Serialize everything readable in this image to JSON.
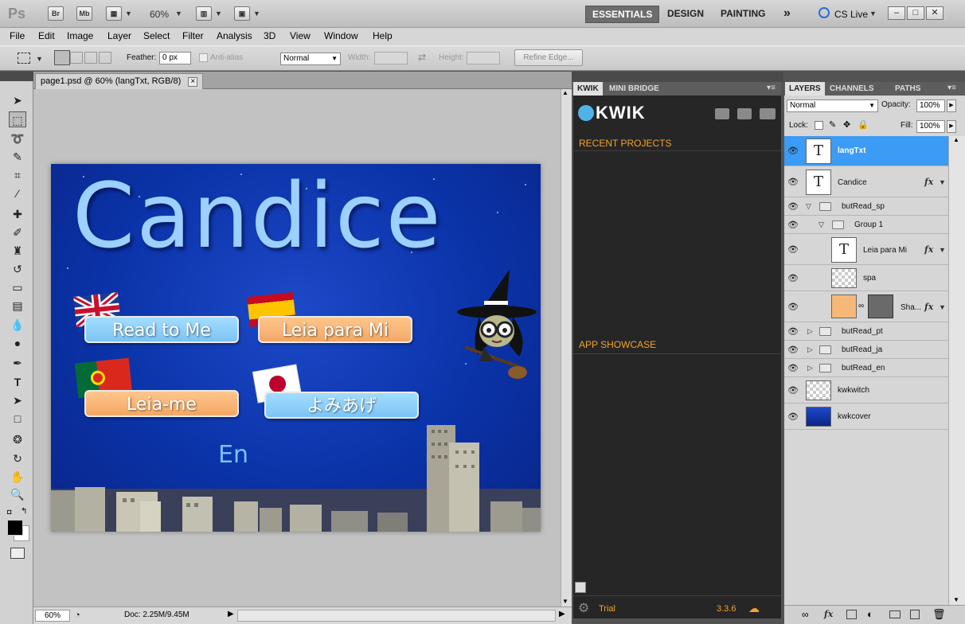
{
  "app": {
    "logo": "Ps",
    "bridge_btn": "Br",
    "minibridge_btn": "Mb",
    "zoom": "60%",
    "workspaces": [
      "ESSENTIALS",
      "DESIGN",
      "PAINTING"
    ],
    "more": "»",
    "cslive": "CS Live"
  },
  "menu": [
    "File",
    "Edit",
    "Image",
    "Layer",
    "Select",
    "Filter",
    "Analysis",
    "3D",
    "View",
    "Window",
    "Help"
  ],
  "options": {
    "feather_label": "Feather:",
    "feather_value": "0 px",
    "antialias_label": "Anti-alias",
    "style_value": "Normal",
    "width_label": "Width:",
    "height_label": "Height:",
    "refine_edge": "Refine Edge..."
  },
  "document": {
    "tab_title": "page1.psd @ 60% (langTxt, RGB/8)",
    "close": "×"
  },
  "artwork": {
    "title": "Candice",
    "buttons": [
      {
        "label": "Read to Me",
        "flag": "uk"
      },
      {
        "label": "Leia para Mi",
        "flag": "spain"
      },
      {
        "label": "Leia-me",
        "flag": "portugal"
      },
      {
        "label": "よみあげ",
        "flag": "japan"
      }
    ],
    "lang_text": "En"
  },
  "status": {
    "zoom": "60%",
    "doc_info": "Doc: 2.25M/9.45M"
  },
  "kwik": {
    "tabs": [
      "KWIK",
      "MINI BRIDGE"
    ],
    "logo": "KWIK",
    "recent_projects": "RECENT PROJECTS",
    "app_showcase": "APP SHOWCASE",
    "footer_status": "Trial",
    "version": "3.3.6"
  },
  "layers": {
    "tabs": [
      "LAYERS",
      "CHANNELS",
      "PATHS"
    ],
    "blend_mode": "Normal",
    "opacity_label": "Opacity:",
    "opacity": "100%",
    "lock_label": "Lock:",
    "fill_label": "Fill:",
    "fill": "100%",
    "items": [
      {
        "name": "langTxt",
        "kind": "text",
        "selected": true
      },
      {
        "name": "Candice",
        "kind": "text",
        "fx": true
      },
      {
        "name": "butRead_sp",
        "kind": "group",
        "expanded": true
      },
      {
        "name": "Group 1",
        "kind": "group",
        "expanded": true
      },
      {
        "name": "Leia para Mi",
        "kind": "text",
        "fx": true
      },
      {
        "name": "spa",
        "kind": "image"
      },
      {
        "name": "Sha...",
        "kind": "shape",
        "fx": true
      },
      {
        "name": "butRead_pt",
        "kind": "group"
      },
      {
        "name": "butRead_ja",
        "kind": "group"
      },
      {
        "name": "butRead_en",
        "kind": "group"
      },
      {
        "name": "kwkwitch",
        "kind": "image"
      },
      {
        "name": "kwkcover",
        "kind": "image"
      }
    ],
    "fx_label": "fx"
  },
  "colors": {
    "selection": "#3b9bf5",
    "kwik_accent": "#f3a22c",
    "sky": "#0a33a8"
  }
}
